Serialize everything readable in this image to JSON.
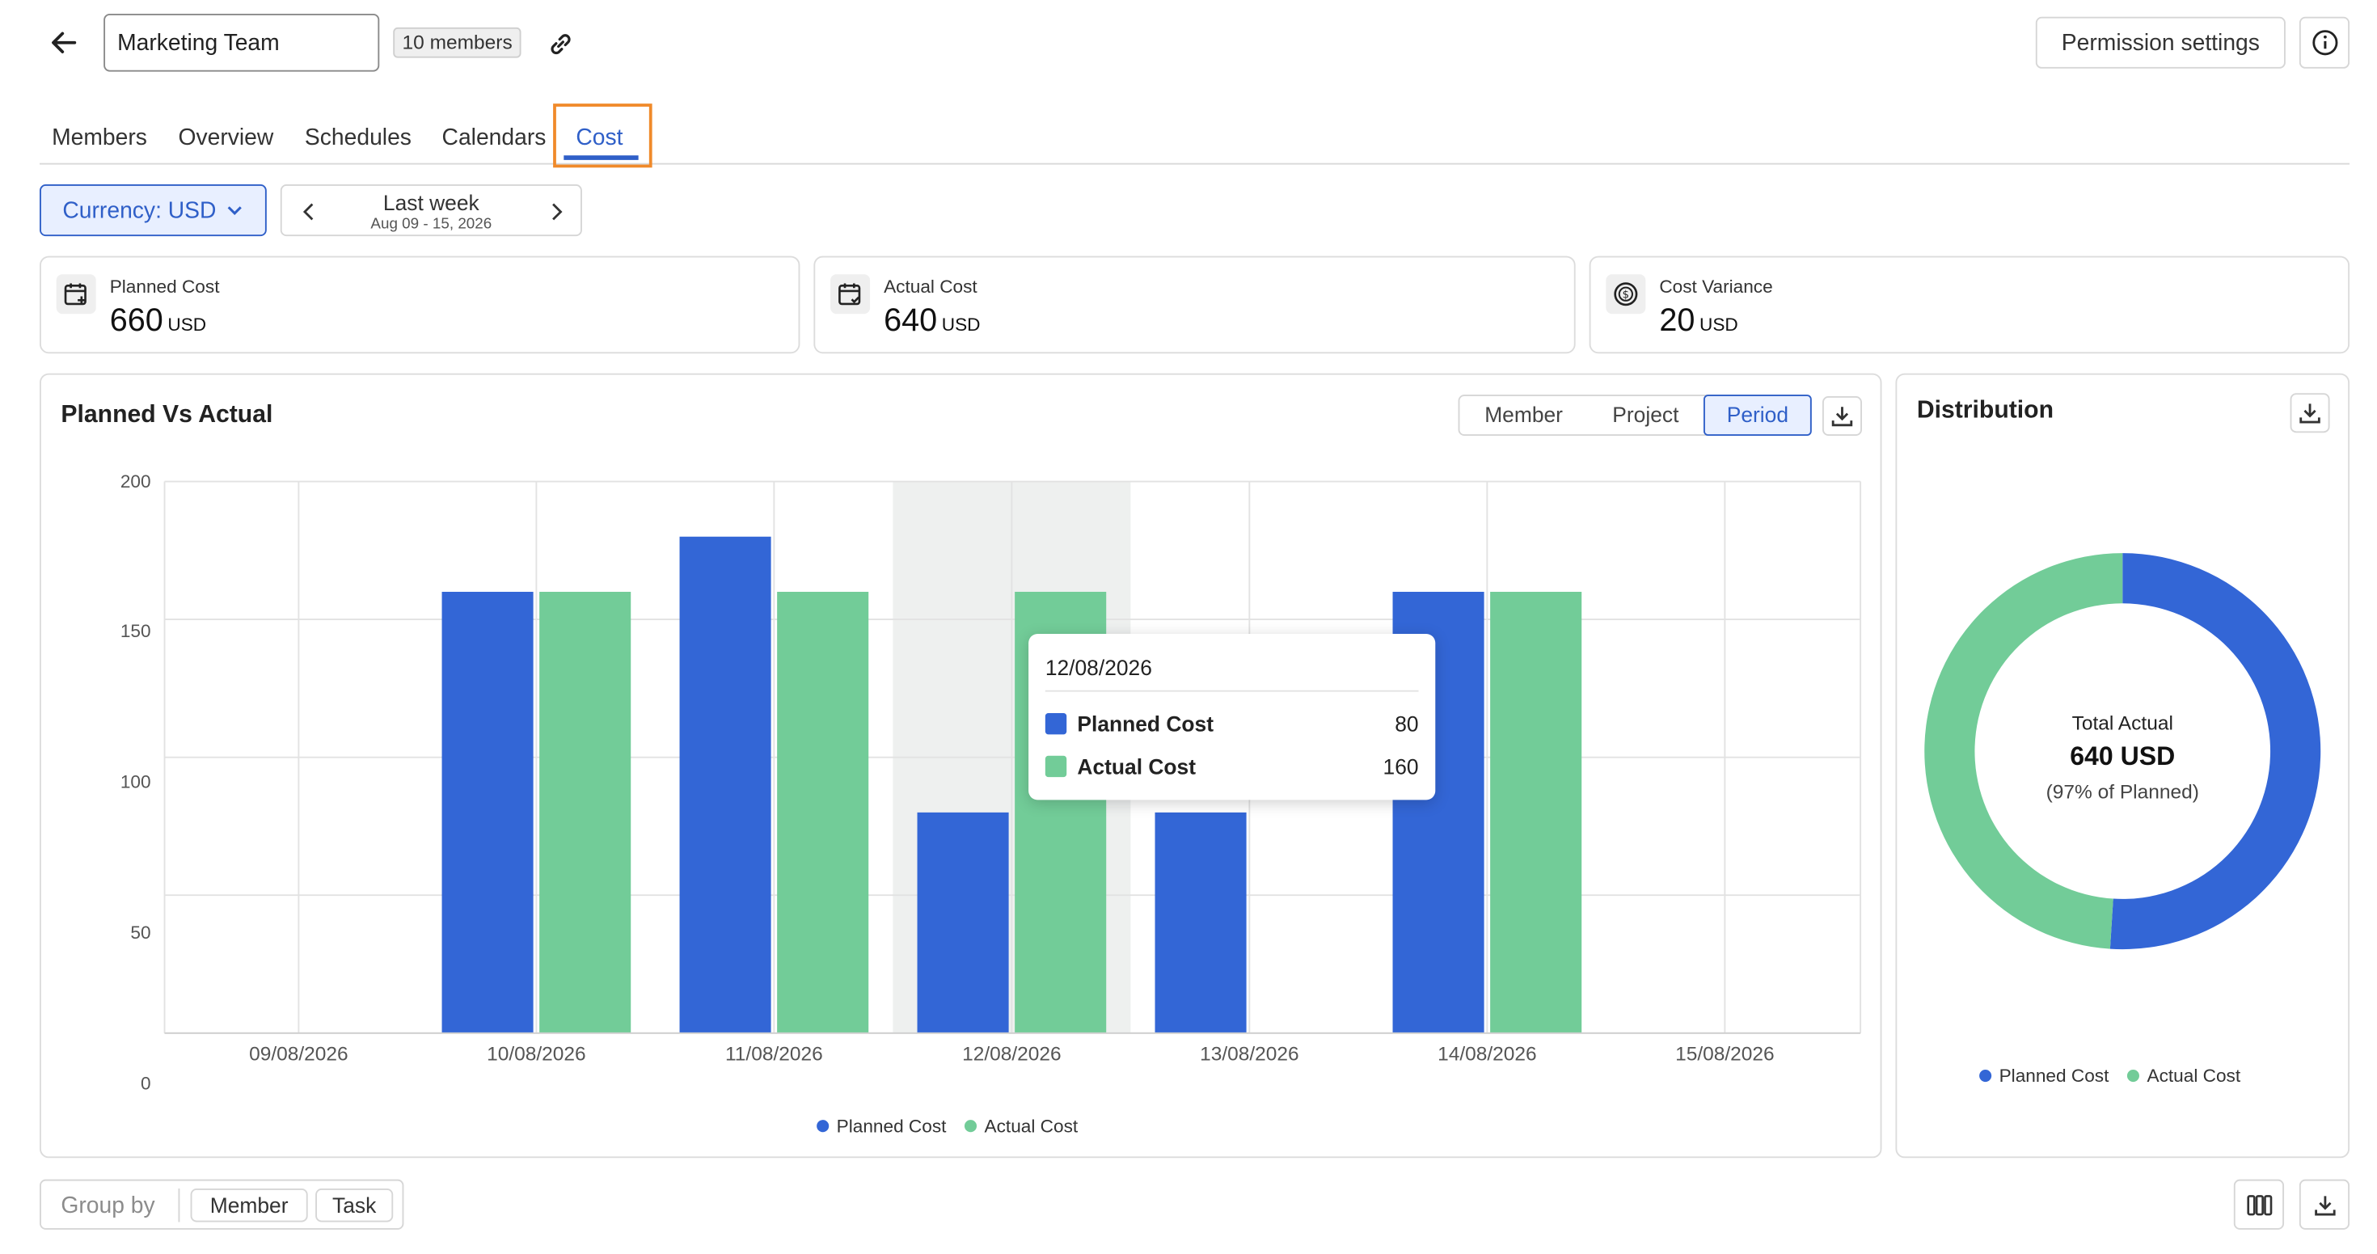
{
  "header": {
    "team_name": "Marketing Team",
    "members_badge": "10 members",
    "permission_settings": "Permission settings"
  },
  "tabs": [
    {
      "label": "Members"
    },
    {
      "label": "Overview"
    },
    {
      "label": "Schedules"
    },
    {
      "label": "Calendars"
    },
    {
      "label": "Cost",
      "active": true
    }
  ],
  "filters": {
    "currency_label": "Currency: USD",
    "period_label": "Last week",
    "period_range": "Aug 09 - 15, 2026"
  },
  "cards": [
    {
      "label": "Planned Cost",
      "value": "660",
      "unit": "USD",
      "icon": "calendar-plus-icon"
    },
    {
      "label": "Actual Cost",
      "value": "640",
      "unit": "USD",
      "icon": "calendar-check-icon"
    },
    {
      "label": "Cost Variance",
      "value": "20",
      "unit": "USD",
      "icon": "dollar-circle-icon"
    }
  ],
  "chart_panel": {
    "title": "Planned Vs Actual",
    "views": [
      "Member",
      "Project",
      "Period"
    ],
    "active_view": "Period"
  },
  "colors": {
    "planned": "#3366d6",
    "actual": "#72cc98",
    "accent": "#2f5fc8",
    "highlight_tab": "#f08a2a"
  },
  "chart_data": [
    {
      "type": "bar",
      "title": "Planned Vs Actual",
      "categories": [
        "09/08/2026",
        "10/08/2026",
        "11/08/2026",
        "12/08/2026",
        "13/08/2026",
        "14/08/2026",
        "15/08/2026"
      ],
      "series": [
        {
          "name": "Planned Cost",
          "values": [
            0,
            160,
            180,
            80,
            80,
            160,
            0
          ]
        },
        {
          "name": "Actual Cost",
          "values": [
            0,
            160,
            160,
            160,
            0,
            160,
            0
          ]
        }
      ],
      "y_ticks": [
        200,
        150,
        100,
        50,
        0
      ],
      "ylim": [
        0,
        200
      ],
      "grid": true,
      "legend": "bottom",
      "highlighted_category": "12/08/2026"
    },
    {
      "type": "pie",
      "title": "Distribution",
      "labels": [
        "Planned Cost",
        "Actual Cost"
      ],
      "values": [
        51,
        49
      ],
      "center_label": "Total Actual",
      "center_value": "640 USD",
      "center_sub": "(97% of Planned)",
      "legend": "bottom"
    }
  ],
  "tooltip": {
    "date": "12/08/2026",
    "rows": [
      {
        "name": "Planned Cost",
        "value": "80"
      },
      {
        "name": "Actual Cost",
        "value": "160"
      }
    ]
  },
  "distribution": {
    "title": "Distribution",
    "center_label": "Total Actual",
    "center_value": "640 USD",
    "center_sub": "(97% of Planned)"
  },
  "legend": {
    "planned": "Planned Cost",
    "actual": "Actual Cost"
  },
  "group_by": {
    "label": "Group by",
    "options": [
      "Member",
      "Task"
    ]
  }
}
